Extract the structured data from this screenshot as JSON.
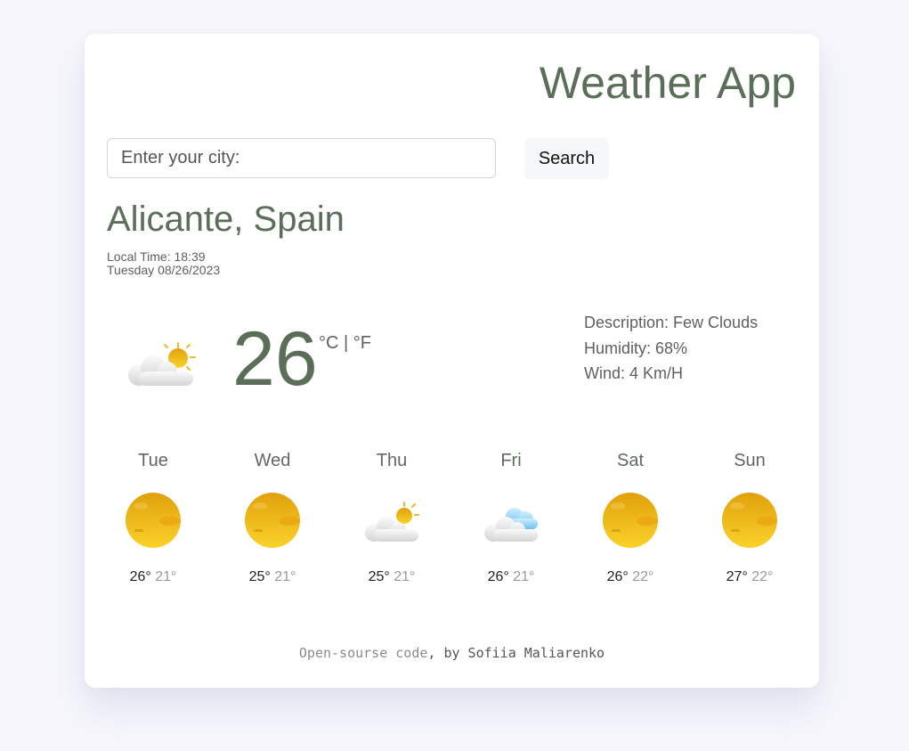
{
  "app": {
    "title": "Weather App"
  },
  "search": {
    "placeholder": "Enter your city:",
    "value": "",
    "button_label": "Search"
  },
  "current": {
    "city": "Alicante, Spain",
    "local_time": "Local Time: 18:39",
    "date": "Tuesday 08/26/2023",
    "temperature": "26",
    "unit_celsius": "°C",
    "unit_separator": "|",
    "unit_fahrenheit": "°F",
    "icon": "few-clouds-icon",
    "description": "Description: Few Clouds",
    "humidity": "Humidity: 68%",
    "wind": "Wind: 4 Km/H"
  },
  "forecast": [
    {
      "day": "Tue",
      "icon": "sun-icon",
      "max": "26°",
      "min": "21°"
    },
    {
      "day": "Wed",
      "icon": "sun-icon",
      "max": "25°",
      "min": "21°"
    },
    {
      "day": "Thu",
      "icon": "few-clouds-icon",
      "max": "25°",
      "min": "21°"
    },
    {
      "day": "Fri",
      "icon": "cloudy-icon",
      "max": "26°",
      "min": "21°"
    },
    {
      "day": "Sat",
      "icon": "sun-icon",
      "max": "26°",
      "min": "22°"
    },
    {
      "day": "Sun",
      "icon": "sun-icon",
      "max": "27°",
      "min": "22°"
    }
  ],
  "footer": {
    "link_text": "Open-sourse code",
    "byline": ", by Sofiia Maliarenko"
  },
  "colors": {
    "accent": "#5a6e58",
    "background": "#f6f6fc",
    "sun": "#f2b824"
  }
}
